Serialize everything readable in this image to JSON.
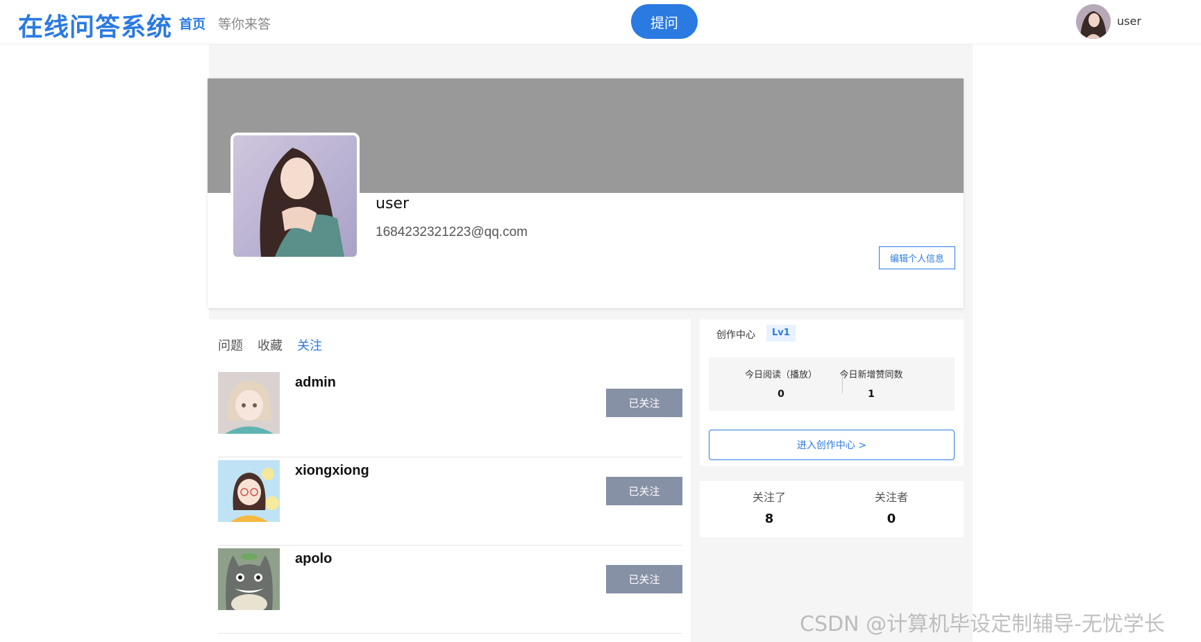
{
  "header": {
    "logo": "在线问答系统",
    "nav": {
      "home": "首页",
      "waiting": "等你来答"
    },
    "ask_button": "提问",
    "user_name": "user"
  },
  "profile": {
    "name": "user",
    "email": "1684232321223@qq.com",
    "edit_button": "编辑个人信息"
  },
  "tabs": {
    "questions": "问题",
    "favorites": "收藏",
    "following": "关注"
  },
  "following_list": [
    {
      "name": "admin",
      "button": "已关注"
    },
    {
      "name": "xiongxiong",
      "button": "已关注"
    },
    {
      "name": "apolo",
      "button": "已关注"
    }
  ],
  "creator": {
    "title": "创作中心",
    "level": "Lv1",
    "reads_label": "今日阅读（播放）",
    "reads_value": "0",
    "likes_label": "今日新增赞同数",
    "likes_value": "1",
    "enter_button": "进入创作中心 >"
  },
  "follow_stats": {
    "following_label": "关注了",
    "following_value": "8",
    "followers_label": "关注者",
    "followers_value": "0"
  },
  "watermark": "CSDN @计算机毕设定制辅导-无忧学长",
  "colors": {
    "accent": "#2a7ae2",
    "banner": "#999999",
    "followed_button": "#8791a5"
  }
}
